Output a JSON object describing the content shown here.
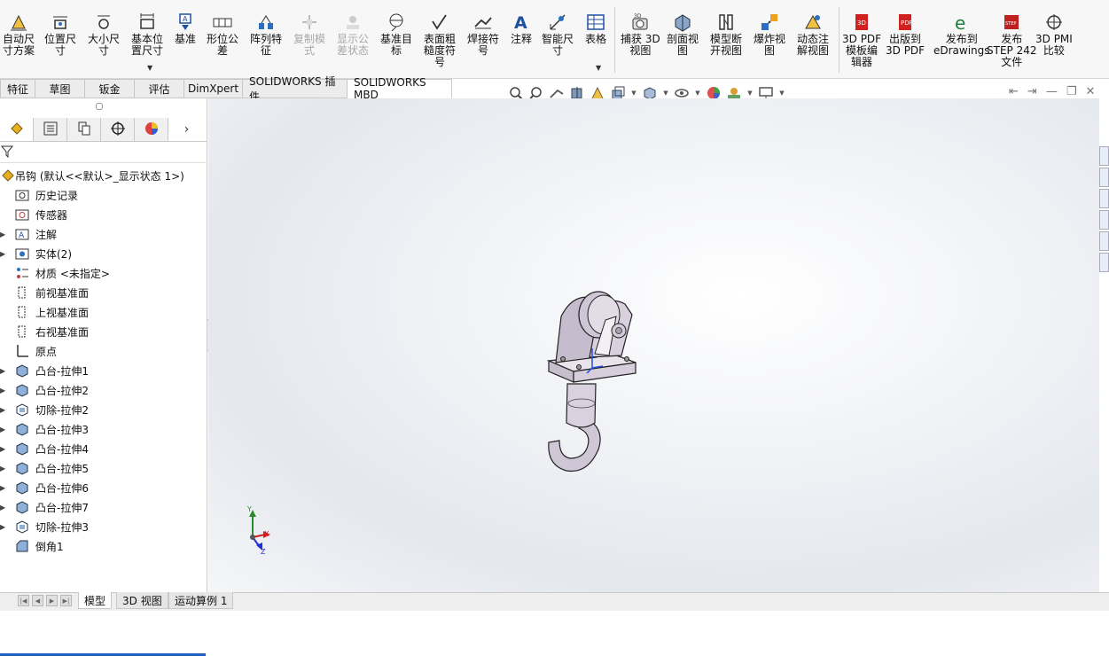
{
  "ribbon": {
    "buttons": [
      {
        "label": "自动尺\n寸方案",
        "icon": "auto-dimension-scheme-icon",
        "enabled": true
      },
      {
        "label": "位置尺\n寸",
        "icon": "location-dimension-icon",
        "enabled": true
      },
      {
        "label": "大小尺\n寸",
        "icon": "size-dimension-icon",
        "enabled": true
      },
      {
        "label": "基本位\n置尺寸",
        "icon": "basic-location-dimension-icon",
        "enabled": true
      },
      {
        "label": "基准",
        "icon": "datum-icon",
        "enabled": true
      },
      {
        "label": "形位公\n差",
        "icon": "geometric-tolerance-icon",
        "enabled": true
      },
      {
        "label": "阵列特\n征",
        "icon": "pattern-feature-icon",
        "enabled": true
      },
      {
        "label": "复制模\n式",
        "icon": "copy-scheme-icon",
        "enabled": false
      },
      {
        "label": "显示公\n差状态",
        "icon": "show-tolerance-status-icon",
        "enabled": false
      },
      {
        "label": "基准目\n标",
        "icon": "datum-target-icon",
        "enabled": true
      },
      {
        "label": "表面粗\n糙度符\n号",
        "icon": "surface-finish-icon",
        "enabled": true
      },
      {
        "label": "焊接符\n号",
        "icon": "weld-symbol-icon",
        "enabled": true
      },
      {
        "label": "注释",
        "icon": "note-icon",
        "enabled": true
      },
      {
        "label": "智能尺\n寸",
        "icon": "smart-dimension-icon",
        "enabled": true
      },
      {
        "label": "表格",
        "icon": "table-icon",
        "enabled": true
      },
      {
        "label": "捕获 3D\n视图",
        "icon": "capture-3d-view-icon",
        "enabled": true
      },
      {
        "label": "剖面视\n图",
        "icon": "section-view-icon",
        "enabled": true
      },
      {
        "label": "模型断\n开视图",
        "icon": "model-break-view-icon",
        "enabled": true
      },
      {
        "label": "爆炸视\n图",
        "icon": "exploded-view-icon",
        "enabled": true
      },
      {
        "label": "动态注\n解视图",
        "icon": "dynamic-annotation-view-icon",
        "enabled": true
      },
      {
        "label": "3D PDF\n模板编\n辑器",
        "icon": "3d-pdf-template-editor-icon",
        "enabled": true
      },
      {
        "label": "出版到\n3D PDF",
        "icon": "publish-3d-pdf-icon",
        "enabled": true
      },
      {
        "label": "发布到\neDrawings",
        "icon": "edrawings-icon",
        "enabled": true
      },
      {
        "label": "发布\nSTEP 242\n文件",
        "icon": "step-242-icon",
        "enabled": true
      },
      {
        "label": "3D PMI\n比较",
        "icon": "3d-pmi-compare-icon",
        "enabled": true
      }
    ]
  },
  "command_tabs": [
    "特征",
    "草图",
    "钣金",
    "评估",
    "DimXpert",
    "SOLIDWORKS 插件",
    "SOLIDWORKS MBD"
  ],
  "feature_tree": {
    "root": "吊钩  (默认<<默认>_显示状态 1>)",
    "items": [
      {
        "label": "历史记录",
        "icon": "history-folder-icon",
        "expandable": false
      },
      {
        "label": "传感器",
        "icon": "sensor-folder-icon",
        "expandable": false
      },
      {
        "label": "注解",
        "icon": "annotations-folder-icon",
        "expandable": true
      },
      {
        "label": "实体(2)",
        "icon": "solid-bodies-folder-icon",
        "expandable": true
      },
      {
        "label": "材质 <未指定>",
        "icon": "material-icon",
        "expandable": false
      },
      {
        "label": "前视基准面",
        "icon": "plane-icon",
        "expandable": false
      },
      {
        "label": "上视基准面",
        "icon": "plane-icon",
        "expandable": false
      },
      {
        "label": "右视基准面",
        "icon": "plane-icon",
        "expandable": false
      },
      {
        "label": "原点",
        "icon": "origin-icon",
        "expandable": false
      },
      {
        "label": "凸台-拉伸1",
        "icon": "boss-extrude-icon",
        "expandable": true
      },
      {
        "label": "凸台-拉伸2",
        "icon": "boss-extrude-icon",
        "expandable": true
      },
      {
        "label": "切除-拉伸2",
        "icon": "cut-extrude-icon",
        "expandable": true
      },
      {
        "label": "凸台-拉伸3",
        "icon": "boss-extrude-icon",
        "expandable": true
      },
      {
        "label": "凸台-拉伸4",
        "icon": "boss-extrude-icon",
        "expandable": true
      },
      {
        "label": "凸台-拉伸5",
        "icon": "boss-extrude-icon",
        "expandable": true
      },
      {
        "label": "凸台-拉伸6",
        "icon": "boss-extrude-icon",
        "expandable": true
      },
      {
        "label": "凸台-拉伸7",
        "icon": "boss-extrude-icon",
        "expandable": true
      },
      {
        "label": "切除-拉伸3",
        "icon": "cut-extrude-icon",
        "expandable": true
      },
      {
        "label": "倒角1",
        "icon": "chamfer-icon",
        "expandable": false
      }
    ]
  },
  "bottom_tabs": [
    "模型",
    "3D 视图",
    "运动算例 1"
  ],
  "triad": {
    "x": "X",
    "y": "Y",
    "z": "Z"
  },
  "colors": {
    "accent": "#1f5fbf",
    "model": "#c9c1cf"
  }
}
